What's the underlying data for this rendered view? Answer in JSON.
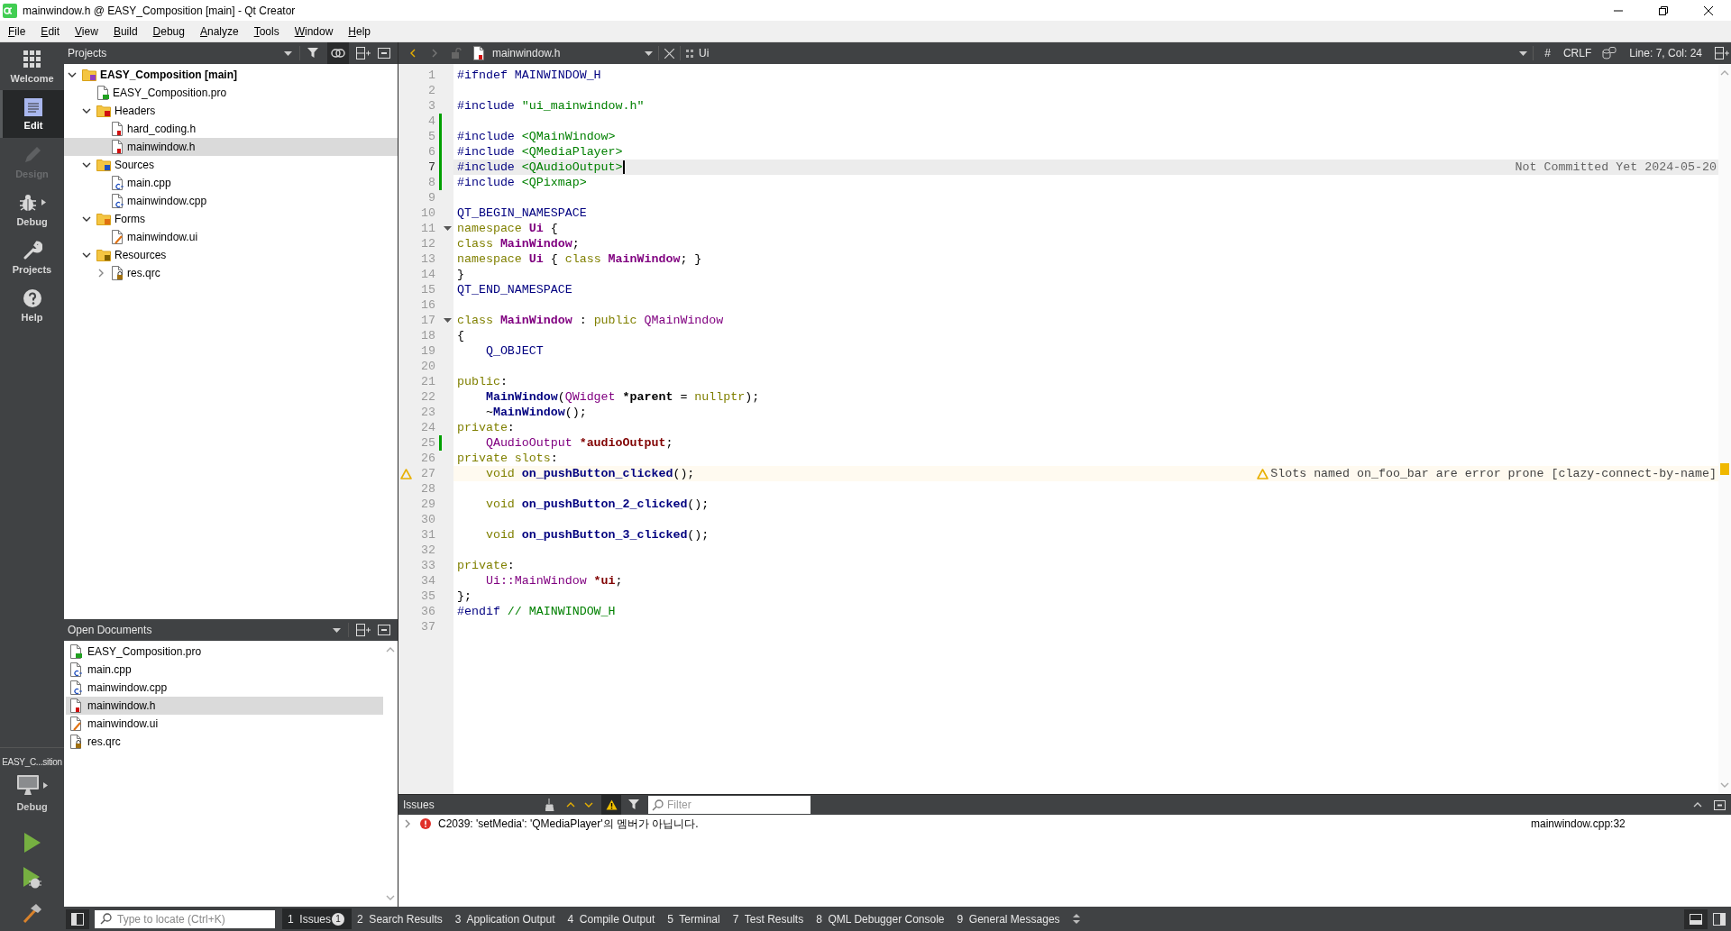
{
  "window": {
    "title": "mainwindow.h @ EASY_Composition [main] - Qt Creator"
  },
  "menu": [
    "File",
    "Edit",
    "View",
    "Build",
    "Debug",
    "Analyze",
    "Tools",
    "Window",
    "Help"
  ],
  "mode_bar": {
    "modes": [
      {
        "label": "Welcome",
        "kind": "welcome",
        "selected": false,
        "disabled": false
      },
      {
        "label": "Edit",
        "kind": "edit",
        "selected": true,
        "disabled": false
      },
      {
        "label": "Design",
        "kind": "design",
        "selected": false,
        "disabled": true
      },
      {
        "label": "Debug",
        "kind": "debug",
        "selected": false,
        "disabled": false
      },
      {
        "label": "Projects",
        "kind": "projects",
        "selected": false,
        "disabled": false
      },
      {
        "label": "Help",
        "kind": "help",
        "selected": false,
        "disabled": false
      }
    ],
    "kit": {
      "project": "EASY_C...sition",
      "build": "Debug"
    }
  },
  "projects": {
    "title": "Projects",
    "sync_with_editor": true,
    "tree": [
      {
        "label": "EASY_Composition [main]",
        "kind": "project",
        "expanded": true,
        "selected": false,
        "children": [
          {
            "label": "EASY_Composition.pro",
            "kind": "pro",
            "selected": false
          },
          {
            "label": "Headers",
            "kind": "headers",
            "expanded": true,
            "selected": false,
            "children": [
              {
                "label": "hard_coding.h",
                "kind": "h",
                "selected": false
              },
              {
                "label": "mainwindow.h",
                "kind": "h",
                "selected": true
              }
            ]
          },
          {
            "label": "Sources",
            "kind": "sources",
            "expanded": true,
            "selected": false,
            "children": [
              {
                "label": "main.cpp",
                "kind": "cpp",
                "selected": false
              },
              {
                "label": "mainwindow.cpp",
                "kind": "cpp",
                "selected": false
              }
            ]
          },
          {
            "label": "Forms",
            "kind": "forms",
            "expanded": true,
            "selected": false,
            "children": [
              {
                "label": "mainwindow.ui",
                "kind": "ui",
                "selected": false
              }
            ]
          },
          {
            "label": "Resources",
            "kind": "resources",
            "expanded": true,
            "selected": false,
            "children": [
              {
                "label": "res.qrc",
                "kind": "qrc",
                "expanded": false,
                "selected": false
              }
            ]
          }
        ]
      }
    ]
  },
  "open_documents": {
    "title": "Open Documents",
    "items": [
      {
        "name": "EASY_Composition.pro",
        "kind": "pro",
        "selected": false
      },
      {
        "name": "main.cpp",
        "kind": "cpp",
        "selected": false
      },
      {
        "name": "mainwindow.cpp",
        "kind": "cpp",
        "selected": false
      },
      {
        "name": "mainwindow.h",
        "kind": "h",
        "selected": true
      },
      {
        "name": "mainwindow.ui",
        "kind": "ui",
        "selected": false
      },
      {
        "name": "res.qrc",
        "kind": "qrc",
        "selected": false
      }
    ]
  },
  "editor": {
    "file": "mainwindow.h",
    "symbol": "Ui",
    "hash": "#",
    "line_ending": "CRLF",
    "position": "Line: 7, Col: 24",
    "lines": [
      {
        "number": "1",
        "changed": false,
        "current": false,
        "warning": false,
        "foldable": false,
        "tokens": [
          {
            "kind": "preproc",
            "text": "#ifndef MAINWINDOW_H"
          }
        ]
      },
      {
        "number": "2",
        "changed": false,
        "current": false,
        "warning": false,
        "foldable": false
      },
      {
        "number": "3",
        "changed": false,
        "current": false,
        "warning": false,
        "foldable": false,
        "tokens": [
          {
            "kind": "preproc",
            "text": "#include "
          },
          {
            "kind": "string",
            "text": "\"ui_mainwindow.h\""
          }
        ]
      },
      {
        "number": "4",
        "changed": true,
        "current": false,
        "warning": false,
        "foldable": false
      },
      {
        "number": "5",
        "changed": true,
        "current": false,
        "warning": false,
        "foldable": false,
        "tokens": [
          {
            "kind": "preproc",
            "text": "#include "
          },
          {
            "kind": "string",
            "text": "<QMainWindow>"
          }
        ]
      },
      {
        "number": "6",
        "changed": true,
        "current": false,
        "warning": false,
        "foldable": false,
        "tokens": [
          {
            "kind": "preproc",
            "text": "#include "
          },
          {
            "kind": "string",
            "text": "<QMediaPlayer>"
          }
        ]
      },
      {
        "number": "7",
        "changed": true,
        "current": true,
        "warning": false,
        "foldable": false,
        "tokens": [
          {
            "kind": "preproc",
            "text": "#include "
          },
          {
            "kind": "string",
            "text": "<QAudioOutput>"
          }
        ],
        "annotation": {
          "kind": "blame",
          "text": "Not Committed Yet 2024-05-20"
        }
      },
      {
        "number": "8",
        "changed": true,
        "current": false,
        "warning": false,
        "foldable": false,
        "tokens": [
          {
            "kind": "preproc",
            "text": "#include "
          },
          {
            "kind": "string",
            "text": "<QPixmap>"
          }
        ]
      },
      {
        "number": "9",
        "changed": false,
        "current": false,
        "warning": false,
        "foldable": false
      },
      {
        "number": "10",
        "changed": false,
        "current": false,
        "warning": false,
        "foldable": false,
        "tokens": [
          {
            "kind": "macro",
            "text": "QT_BEGIN_NAMESPACE"
          }
        ]
      },
      {
        "number": "11",
        "changed": false,
        "current": false,
        "warning": false,
        "foldable": true,
        "tokens": [
          {
            "kind": "keyword",
            "text": "namespace "
          },
          {
            "kind": "classdecl",
            "text": "Ui"
          },
          {
            "kind": "plain",
            "text": " {"
          }
        ]
      },
      {
        "number": "12",
        "changed": false,
        "current": false,
        "warning": false,
        "foldable": false,
        "tokens": [
          {
            "kind": "keyword",
            "text": "class "
          },
          {
            "kind": "classdecl",
            "text": "MainWindow"
          },
          {
            "kind": "plain",
            "text": ";"
          }
        ]
      },
      {
        "number": "13",
        "changed": false,
        "current": false,
        "warning": false,
        "foldable": false,
        "tokens": [
          {
            "kind": "keyword",
            "text": "namespace "
          },
          {
            "kind": "classdecl",
            "text": "Ui"
          },
          {
            "kind": "plain",
            "text": " { "
          },
          {
            "kind": "keyword",
            "text": "class "
          },
          {
            "kind": "classdecl",
            "text": "MainWindow"
          },
          {
            "kind": "plain",
            "text": "; }"
          }
        ]
      },
      {
        "number": "14",
        "changed": false,
        "current": false,
        "warning": false,
        "foldable": false,
        "tokens": [
          {
            "kind": "plain",
            "text": "}"
          }
        ]
      },
      {
        "number": "15",
        "changed": false,
        "current": false,
        "warning": false,
        "foldable": false,
        "tokens": [
          {
            "kind": "macro",
            "text": "QT_END_NAMESPACE"
          }
        ]
      },
      {
        "number": "16",
        "changed": false,
        "current": false,
        "warning": false,
        "foldable": false
      },
      {
        "number": "17",
        "changed": false,
        "current": false,
        "warning": false,
        "foldable": true,
        "tokens": [
          {
            "kind": "keyword",
            "text": "class "
          },
          {
            "kind": "classdecl",
            "text": "MainWindow"
          },
          {
            "kind": "plain",
            "text": " : "
          },
          {
            "kind": "keyword",
            "text": "public "
          },
          {
            "kind": "type",
            "text": "QMainWindow"
          }
        ]
      },
      {
        "number": "18",
        "changed": false,
        "current": false,
        "warning": false,
        "foldable": false,
        "tokens": [
          {
            "kind": "plain",
            "text": "{"
          }
        ]
      },
      {
        "number": "19",
        "changed": false,
        "current": false,
        "warning": false,
        "foldable": false,
        "tokens": [
          {
            "kind": "macro",
            "text": "    Q_OBJECT"
          }
        ]
      },
      {
        "number": "20",
        "changed": false,
        "current": false,
        "warning": false,
        "foldable": false
      },
      {
        "number": "21",
        "changed": false,
        "current": false,
        "warning": false,
        "foldable": false,
        "tokens": [
          {
            "kind": "keyword",
            "text": "public"
          },
          {
            "kind": "plain",
            "text": ":"
          }
        ]
      },
      {
        "number": "22",
        "changed": false,
        "current": false,
        "warning": false,
        "foldable": false,
        "tokens": [
          {
            "kind": "funcdecl",
            "text": "    MainWindow"
          },
          {
            "kind": "plain",
            "text": "("
          },
          {
            "kind": "type",
            "text": "QWidget "
          },
          {
            "kind": "param",
            "text": "*parent"
          },
          {
            "kind": "plain",
            "text": " = "
          },
          {
            "kind": "keyword",
            "text": "nullptr"
          },
          {
            "kind": "plain",
            "text": ");"
          }
        ]
      },
      {
        "number": "23",
        "changed": false,
        "current": false,
        "warning": false,
        "foldable": false,
        "tokens": [
          {
            "kind": "plain",
            "text": "    ~"
          },
          {
            "kind": "funcdecl",
            "text": "MainWindow"
          },
          {
            "kind": "plain",
            "text": "();"
          }
        ]
      },
      {
        "number": "24",
        "changed": false,
        "current": false,
        "warning": false,
        "foldable": false,
        "tokens": [
          {
            "kind": "keyword",
            "text": "private"
          },
          {
            "kind": "plain",
            "text": ":"
          }
        ]
      },
      {
        "number": "25",
        "changed": true,
        "current": false,
        "warning": false,
        "foldable": false,
        "tokens": [
          {
            "kind": "type",
            "text": "    QAudioOutput "
          },
          {
            "kind": "field",
            "text": "*audioOutput"
          },
          {
            "kind": "plain",
            "text": ";"
          }
        ]
      },
      {
        "number": "26",
        "changed": false,
        "current": false,
        "warning": false,
        "foldable": false,
        "tokens": [
          {
            "kind": "keyword",
            "text": "private slots"
          },
          {
            "kind": "plain",
            "text": ":"
          }
        ]
      },
      {
        "number": "27",
        "changed": false,
        "current": false,
        "warning": true,
        "foldable": false,
        "tokens": [
          {
            "kind": "keyword",
            "text": "    void "
          },
          {
            "kind": "funcdecl",
            "text": "on_pushButton_clicked"
          },
          {
            "kind": "plain",
            "text": "();"
          }
        ],
        "annotation": {
          "kind": "warning",
          "text": "Slots named on_foo_bar are error prone [clazy-connect-by-name]"
        }
      },
      {
        "number": "28",
        "changed": false,
        "current": false,
        "warning": false,
        "foldable": false
      },
      {
        "number": "29",
        "changed": false,
        "current": false,
        "warning": false,
        "foldable": false,
        "tokens": [
          {
            "kind": "keyword",
            "text": "    void "
          },
          {
            "kind": "funcdecl",
            "text": "on_pushButton_2_clicked"
          },
          {
            "kind": "plain",
            "text": "();"
          }
        ]
      },
      {
        "number": "30",
        "changed": false,
        "current": false,
        "warning": false,
        "foldable": false
      },
      {
        "number": "31",
        "changed": false,
        "current": false,
        "warning": false,
        "foldable": false,
        "tokens": [
          {
            "kind": "keyword",
            "text": "    void "
          },
          {
            "kind": "funcdecl",
            "text": "on_pushButton_3_clicked"
          },
          {
            "kind": "plain",
            "text": "();"
          }
        ]
      },
      {
        "number": "32",
        "changed": false,
        "current": false,
        "warning": false,
        "foldable": false
      },
      {
        "number": "33",
        "changed": false,
        "current": false,
        "warning": false,
        "foldable": false,
        "tokens": [
          {
            "kind": "keyword",
            "text": "private"
          },
          {
            "kind": "plain",
            "text": ":"
          }
        ]
      },
      {
        "number": "34",
        "changed": false,
        "current": false,
        "warning": false,
        "foldable": false,
        "tokens": [
          {
            "kind": "type",
            "text": "    Ui::MainWindow "
          },
          {
            "kind": "field",
            "text": "*ui"
          },
          {
            "kind": "plain",
            "text": ";"
          }
        ]
      },
      {
        "number": "35",
        "changed": false,
        "current": false,
        "warning": false,
        "foldable": false,
        "tokens": [
          {
            "kind": "plain",
            "text": "};"
          }
        ]
      },
      {
        "number": "36",
        "changed": false,
        "current": false,
        "warning": false,
        "foldable": false,
        "tokens": [
          {
            "kind": "preproc",
            "text": "#endif "
          },
          {
            "kind": "comment",
            "text": "// MAINWINDOW_H"
          }
        ]
      },
      {
        "number": "37",
        "changed": false,
        "current": false,
        "warning": false,
        "foldable": false
      }
    ]
  },
  "issues": {
    "title": "Issues",
    "show_warnings": true,
    "filter_placeholder": "Filter",
    "items": [
      {
        "message": "C2039: 'setMedia': 'QMediaPlayer'의 멤버가 아닙니다.",
        "location": "mainwindow.cpp:32"
      }
    ]
  },
  "bottom_bar": {
    "locator_placeholder": "Type to locate (Ctrl+K)",
    "tabs": [
      {
        "number": "1",
        "label": "Issues",
        "badge": "1",
        "selected": true
      },
      {
        "number": "2",
        "label": "Search Results",
        "selected": false
      },
      {
        "number": "3",
        "label": "Application Output",
        "selected": false
      },
      {
        "number": "4",
        "label": "Compile Output",
        "selected": false
      },
      {
        "number": "5",
        "label": "Terminal",
        "selected": false
      },
      {
        "number": "7",
        "label": "Test Results",
        "selected": false
      },
      {
        "number": "8",
        "label": "QML Debugger Console",
        "selected": false
      },
      {
        "number": "9",
        "label": "General Messages",
        "selected": false
      }
    ]
  }
}
